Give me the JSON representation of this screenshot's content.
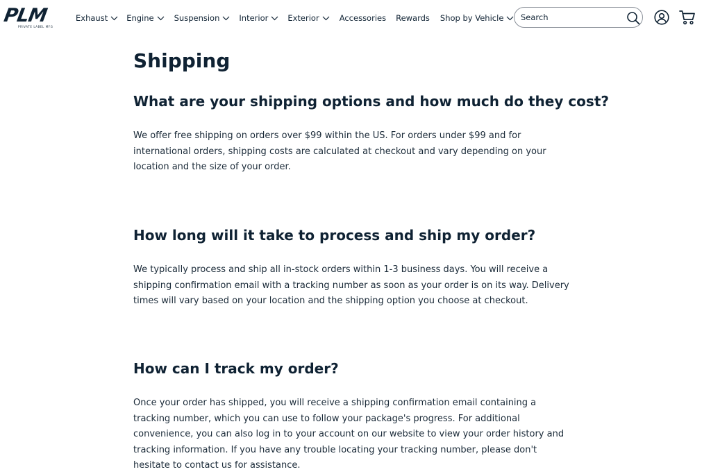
{
  "brand": {
    "logo_text": "PLM",
    "logo_subtext": "PRIVATE LABEL MFG"
  },
  "nav": {
    "items": [
      {
        "label": "Exhaust",
        "has_dropdown": true
      },
      {
        "label": "Engine",
        "has_dropdown": true
      },
      {
        "label": "Suspension",
        "has_dropdown": true
      },
      {
        "label": "Interior",
        "has_dropdown": true
      },
      {
        "label": "Exterior",
        "has_dropdown": true
      },
      {
        "label": "Accessories",
        "has_dropdown": false
      },
      {
        "label": "Rewards",
        "has_dropdown": false
      },
      {
        "label": "Shop by Vehicle",
        "has_dropdown": true
      }
    ]
  },
  "search": {
    "placeholder": "Search",
    "icon": "search-icon"
  },
  "header_icons": {
    "account": "account-icon",
    "cart": "cart-icon"
  },
  "page": {
    "title": "Shipping",
    "faqs": [
      {
        "question": "What are your shipping options and how much do they cost?",
        "answer": "We offer free shipping on orders over $99 within the US. For orders under $99 and for international orders, shipping costs are calculated at checkout and vary depending on your location and the size of your order."
      },
      {
        "question": "How long will it take to process and ship my order?",
        "answer": "We typically process and ship all in-stock orders within 1-3 business days. You will receive a shipping confirmation email with a tracking number as soon as your order is on its way. Delivery times will vary based on your location and the shipping option you choose at checkout."
      },
      {
        "question": "How can I track my order?",
        "answer": "Once your order has shipped, you will receive a shipping confirmation email containing a tracking number, which you can use to follow your package's progress. For additional convenience, you can also log in to your account on our website to view your order history and tracking information. If you have any trouble locating your tracking number, please don't hesitate to contact us for assistance."
      }
    ]
  },
  "colors": {
    "text_primary": "#0f2233",
    "background": "#ffffff",
    "border": "#8a9099"
  }
}
